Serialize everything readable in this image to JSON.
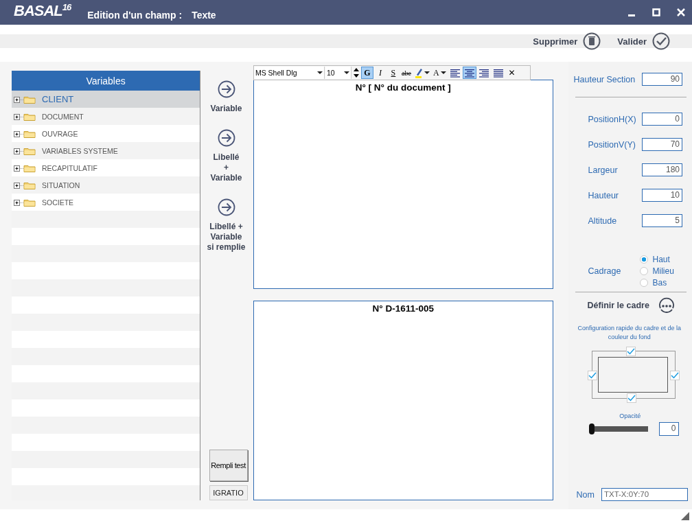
{
  "app": {
    "logo": "BASAL",
    "logo_version": "16",
    "title": "Edition d'un champ :",
    "subtitle": "Texte"
  },
  "actions": [
    {
      "label": "Supprimer",
      "kind": "delete"
    },
    {
      "label": "Valider",
      "kind": "validate"
    }
  ],
  "variables": {
    "title": "Variables",
    "items": [
      {
        "label": "CLIENT",
        "selected": true
      },
      {
        "label": "DOCUMENT",
        "selected": false
      },
      {
        "label": "OUVRAGE",
        "selected": false
      },
      {
        "label": "VARIABLES SYSTEME",
        "selected": false
      },
      {
        "label": "RECAPITULATIF",
        "selected": false
      },
      {
        "label": "SITUATION",
        "selected": false
      },
      {
        "label": "SOCIETE",
        "selected": false
      }
    ]
  },
  "insert_buttons": [
    {
      "lines": [
        "Variable"
      ]
    },
    {
      "lines": [
        "Libellé",
        "+",
        "Variable"
      ]
    },
    {
      "lines": [
        "Libellé +",
        "Variable",
        "si remplie"
      ]
    }
  ],
  "test_button": "Rempli test",
  "test_field": "IGRATIO",
  "toolbar": {
    "font": "MS Shell Dlg",
    "size": "10",
    "buttons": [
      {
        "kind": "bold",
        "label": "G",
        "selected": true
      },
      {
        "kind": "italic",
        "label": "I",
        "selected": false
      },
      {
        "kind": "underline",
        "label": "S",
        "selected": false
      },
      {
        "kind": "strike",
        "label": "abe",
        "selected": false
      },
      {
        "kind": "highlight",
        "selected": false
      },
      {
        "kind": "color",
        "label": "A",
        "selected": false
      },
      {
        "kind": "align-left",
        "selected": false
      },
      {
        "kind": "align-center",
        "selected": true
      },
      {
        "kind": "align-right",
        "selected": false
      },
      {
        "kind": "justify",
        "selected": false
      },
      {
        "kind": "close",
        "label": "✕",
        "selected": false
      }
    ]
  },
  "editor_text": "N° [ N° du document ]",
  "preview_text": "N° D-1611-005",
  "properties": {
    "section": {
      "label": "Hauteur Section",
      "value": "90"
    },
    "fields": [
      {
        "label": "PositionH(X)",
        "value": "0"
      },
      {
        "label": "PositionV(Y)",
        "value": "70"
      },
      {
        "label": "Largeur",
        "value": "180"
      },
      {
        "label": "Hauteur",
        "value": "10"
      },
      {
        "label": "Altitude",
        "value": "5"
      }
    ],
    "cadrage": {
      "label": "Cadrage",
      "options": [
        {
          "label": "Haut",
          "selected": true
        },
        {
          "label": "Milieu",
          "selected": false
        },
        {
          "label": "Bas",
          "selected": false
        }
      ]
    },
    "frame_title": "Définir le cadre",
    "frame_caption": "Configuration rapide du cadre et de la couleur du fond",
    "borders": {
      "top": true,
      "left": true,
      "right": true,
      "bottom": true
    },
    "opacity": {
      "label": "Opacité",
      "level": 0,
      "value": "0"
    },
    "name": {
      "label": "Nom",
      "value": "TXT-X:0Y:70"
    }
  }
}
